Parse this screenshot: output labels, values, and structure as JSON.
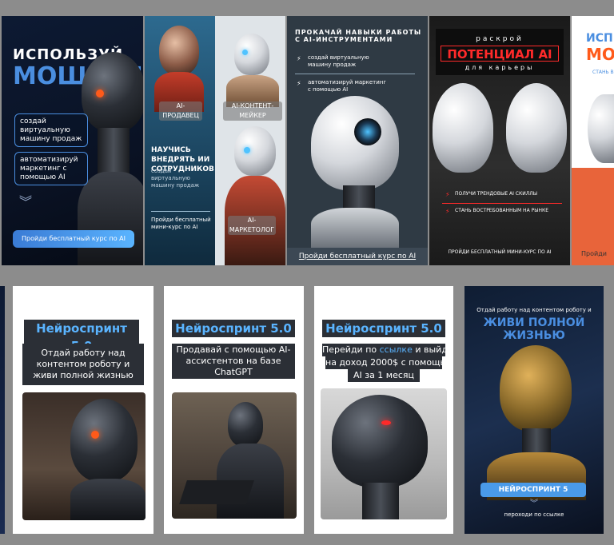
{
  "top": {
    "card1": {
      "headline_1": "ИСПОЛЬЗУЙ",
      "headline_2": "МОЩЬ AI",
      "bullet_1": "создай виртуальную машину продаж",
      "bullet_2": "автоматизируй маркетинг с помощью AI",
      "cta": "Пройди бесплатный курс по AI"
    },
    "card2": {
      "tag_1": "AI-ПРОДАВЕЦ",
      "tag_2": "AI-КОНТЕНТ-МЕЙКЕР",
      "tag_3": "AI-МАРКЕТОЛОГ",
      "heading": "НАУЧИСЬ ВНЕДРЯТЬ ИИ СОТРУДНИКОВ",
      "sub": "создай виртуальную машину продаж",
      "cta": "Пройди бесплатный мини-курс по AI"
    },
    "card3": {
      "headline_1": "ПРОКАЧАЙ НАВЫКИ РАБОТЫ",
      "headline_2": "С AI-ИНСТРУМЕНТАМИ",
      "bullet_1": "создай виртуальную машину продаж",
      "bullet_2": "автоматизируй маркетинг с помощью AI",
      "cta": "Пройди бесплатный курс по AI"
    },
    "card4": {
      "top": "раскрой",
      "main": "ПОТЕНЦИАЛ AI",
      "bottom": "для карьеры",
      "bullet_1": "ПОЛУЧИ ТРЕНДОВЫЕ AI СКИЛЛЫ",
      "bullet_2": "СТАНЬ ВОСТРЕБОВАННЫМ НА РЫНКЕ",
      "cta": "ПРОЙДИ БЕСПЛАТНЫЙ МИНИ-КУРС ПО AI"
    },
    "card5": {
      "headline_1": "ИСП",
      "headline_2": "МО",
      "sub": "СТАНЬ В",
      "cta": "Пройди"
    }
  },
  "bottom": {
    "card1": {
      "title": "Нейроспринт 5.0",
      "text": "Отдай работу над контентом роботу и живи полной жизнью"
    },
    "card2": {
      "title": "Нейроспринт 5.0",
      "text": "Продавай с помощью AI-ассистентов на базе ChatGPT"
    },
    "card3": {
      "title": "Нейроспринт 5.0",
      "text_line_1_pre": "Перейди по",
      "text_line_1_link": "ссылке",
      "text_line_1_post": "и выйди",
      "text_line_2": "на доход 2000$ с помощью",
      "text_line_3": "AI за 1 месяц"
    },
    "card4": {
      "top": "Отдай работу над контентом роботу и",
      "headline": "ЖИВИ ПОЛНОЙ ЖИЗНЬЮ",
      "badge": "НЕЙРОСПРИНТ 5",
      "cta": "пероходи по ссылке"
    }
  },
  "colors": {
    "page_bg": "#8c8c8c",
    "blue_accent": "#4a8ee0",
    "red_accent": "#e02020",
    "sprint_blue": "#5ab4ff",
    "dark_box": "#2b2f36"
  }
}
